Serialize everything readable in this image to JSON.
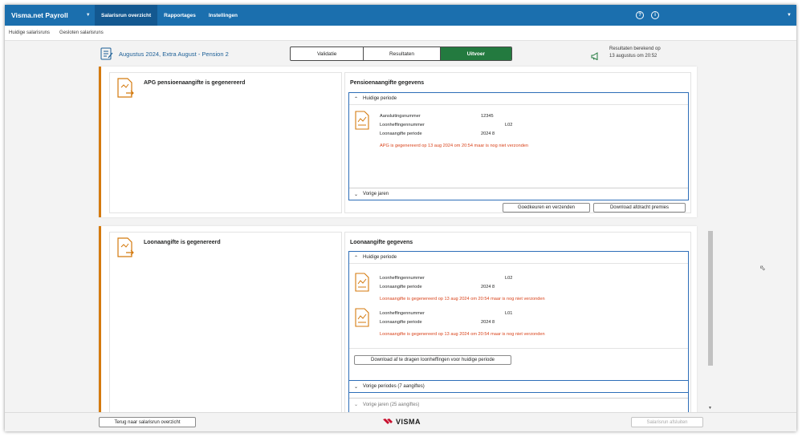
{
  "app": {
    "title": "Visma.net Payroll"
  },
  "nav": {
    "items": [
      "Salarisrun overzicht",
      "Rapportages",
      "Instellingen"
    ],
    "help": "?",
    "accessibility": "i"
  },
  "subnav": {
    "items": [
      "Huidige salarisruns",
      "Gesloten salarisruns"
    ]
  },
  "run": {
    "title": "Augustus 2024, Extra August - Pension 2",
    "tabs": [
      "Validatie",
      "Resultaten",
      "Uitvoer"
    ],
    "active_tab": "Uitvoer",
    "result_line1": "Resultaten berekend op",
    "result_line2": "13 augustus om 20:52"
  },
  "card1": {
    "left_title": "APG pensioenaangifte is gegenereerd",
    "right_title": "Pensioenaangifte gegevens",
    "current": "Huidige periode",
    "previous": "Vorige jaren",
    "entry": {
      "k1": "Aansluitingsnummer",
      "v1": "12345",
      "k2": "Loonheffingennummer",
      "v2": "L02",
      "k3": "Loonaangifte periode",
      "v3": "2024 8",
      "warning": "APG is gegenereerd op 13 aug 2024 om 20:54 maar is nog niet verzonden"
    },
    "btn_approve": "Goedkeuren en verzenden",
    "btn_download": "Download afdracht premies"
  },
  "card2": {
    "left_title": "Loonaangifte is gegenereerd",
    "right_title": "Loonaangifte gegevens",
    "current": "Huidige periode",
    "entries": [
      {
        "k1": "Loonheffingennummer",
        "v1": "L02",
        "k2": "Loonaangifte periode",
        "v2": "2024 8",
        "warning": "Loonaangifte is gegenereerd op 13 aug 2024 om 20:54 maar is nog niet verzonden"
      },
      {
        "k1": "Loonheffingennummer",
        "v1": "L01",
        "k2": "Loonaangifte periode",
        "v2": "2024 8",
        "warning": "Loonaangifte is gegenereerd op 13 aug 2024 om 20:54 maar is nog niet verzonden"
      }
    ],
    "btn_download": "Download af te dragen loonheffingen voor huidige periode",
    "previous": "Vorige periodes (7 aangiftes)",
    "previous_years": "Vorige jaren (25 aangiftes)"
  },
  "footer": {
    "back": "Terug naar salarisrun overzicht",
    "logo": "VISMA",
    "close": "Salarisrun afsluiten"
  },
  "colors": {
    "nav": "#1b6fae",
    "accent": "#d47a0e",
    "active_tab": "#237a3f",
    "warning": "#d9441c",
    "accordion": "#2d6eb8"
  }
}
